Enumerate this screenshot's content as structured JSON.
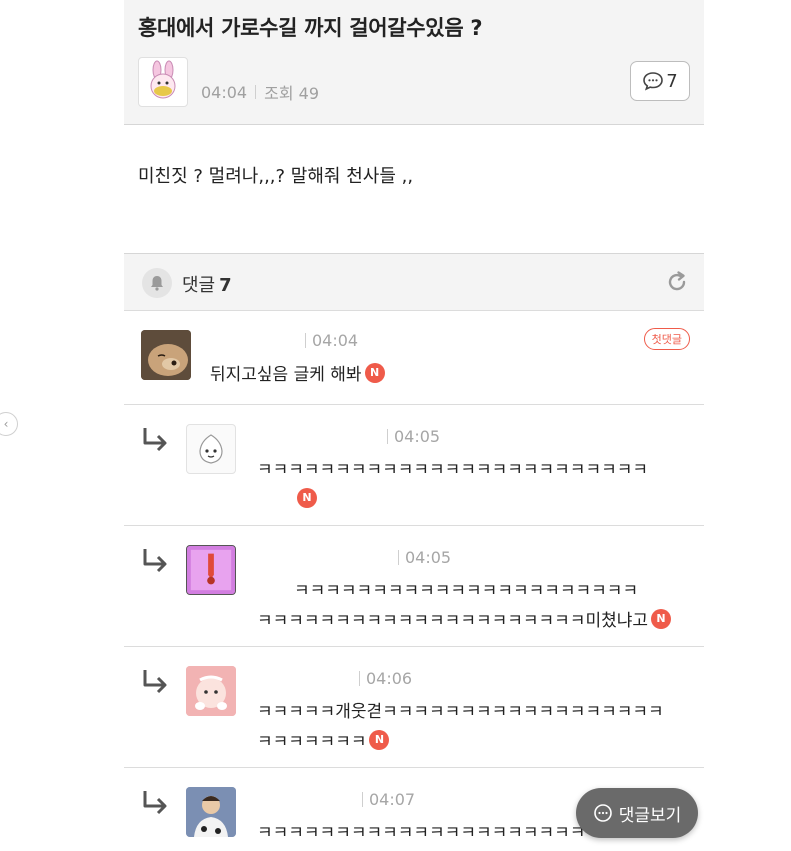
{
  "post": {
    "title": "홍대에서 가로수길 까지 걸어갈수있음 ?",
    "time": "04:04",
    "views_label": "조회 49",
    "comment_count": "7",
    "body": "미친짓 ? 멀려나,,,? 말해줘 천사들 ,,"
  },
  "comments_header": {
    "label": "댓글",
    "count": "7"
  },
  "comments": [
    {
      "time": "04:04",
      "lines": [
        "뒤지고싶음 글케 해봐"
      ],
      "badge": "N",
      "first_label": "첫댓글"
    },
    {
      "time": "04:05",
      "lines": [
        "ㅋㅋㅋㅋㅋㅋㅋㅋㅋㅋㅋㅋㅋㅋㅋㅋㅋㅋㅋㅋㅋㅋㅋㅋㅋ",
        ""
      ],
      "badge": "N"
    },
    {
      "time": "04:05",
      "lines": [
        "ㅋㅋㅋㅋㅋㅋㅋㅋㅋㅋㅋㅋㅋㅋㅋㅋㅋㅋㅋㅋㅋㅋ",
        "ㅋㅋㅋㅋㅋㅋㅋㅋㅋㅋㅋㅋㅋㅋㅋㅋㅋㅋㅋㅋㅋ미쳤냐고"
      ],
      "badge": "N"
    },
    {
      "time": "04:06",
      "lines": [
        "ㅋㅋㅋㅋㅋ개웃겯ㅋㅋㅋㅋㅋㅋㅋㅋㅋㅋㅋㅋㅋㅋㅋㅋㅋㅋ",
        "ㅋㅋㅋㅋㅋㅋㅋ"
      ],
      "badge": "N"
    },
    {
      "time": "04:07",
      "lines": [
        "ㅋㅋㅋㅋㅋㅋㅋㅋㅋㅋㅋㅋㅋㅋㅋㅋㅋㅋㅋㅋㅋㅋㅋㅋㅋ"
      ]
    }
  ],
  "view_comments_button": "댓글보기",
  "colors": {
    "accent": "#ef5b4a",
    "header_bg": "#f4f4f4",
    "button_bg": "#6a6a6a"
  }
}
